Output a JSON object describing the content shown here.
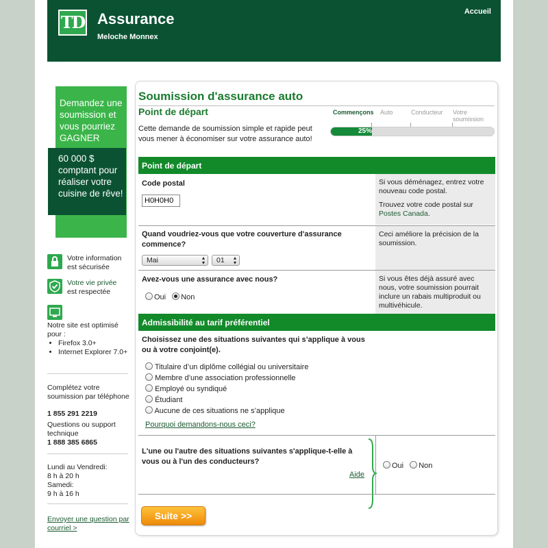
{
  "header": {
    "logo_text": "TD",
    "brand_title": "Assurance",
    "brand_sub": "Meloche Monnex",
    "home_link": "Accueil",
    "bg_color": "#0b5233"
  },
  "promo": {
    "top_text": "Demandez une soumission et vous pourriez GAGNER",
    "bottom_text": "60 000 $ comptant pour réaliser votre cuisine de rêve!"
  },
  "sidebar": {
    "secure": {
      "line1": "Votre information",
      "line2": "est sécurisée",
      "icon": "lock-icon"
    },
    "privacy": {
      "link": "Votre vie privée",
      "line2": "est respectée",
      "icon": "shield-check-icon"
    },
    "browser": {
      "intro": "Notre site est optimisé pour :",
      "items": [
        "Firefox 3.0+",
        "Internet Explorer 7.0+"
      ],
      "icon": "monitor-icon"
    },
    "phone_intro": "Complétez votre soumission par téléphone",
    "phone_number": "1 855 291 2219",
    "support_intro": "Questions ou support technique",
    "support_number": "1 888 385 6865",
    "hours_line1": "Lundi au Vendredi:",
    "hours_line2": "8 h à 20 h",
    "hours_line3": "Samedi:",
    "hours_line4": "9 h à 16 h",
    "email_link": "Envoyer une question par courriel >"
  },
  "form": {
    "title": "Soumission d'assurance auto",
    "subtitle": "Point de départ",
    "intro": "Cette demande de soumission simple et rapide peut vous mener à économiser sur votre assurance auto!",
    "steps": [
      "Commençons",
      "Auto",
      "Conducteur",
      "Votre soumission"
    ],
    "progress_label": "25%",
    "progress_value": 0.25,
    "section1_title": "Point de départ",
    "postal_label": "Code postal",
    "postal_value": "H0H0H0",
    "postal_help1": "Si vous déménagez, entrez votre nouveau code postal.",
    "postal_help2": "Trouvez votre code postal sur",
    "postal_help_link": "Postes Canada",
    "postal_help_end": ".",
    "start_label": "Quand voudriez-vous que votre couverture d'assurance commence?",
    "start_month": "Mai",
    "start_day": "01",
    "start_help": "Ceci améliore la précision de la soumission.",
    "insured_label": "Avez-vous une assurance avec nous?",
    "yes": "Oui",
    "no": "Non",
    "insured_help": "Si vous êtes déjà assuré avec nous, votre soumission pourrait inclure un rabais multiproduit ou multivéhicule.",
    "section2_title": "Admissibilité au tarif préférentiel",
    "situation_label": "Choisissez une des situations suivantes qui s’applique à vous ou à votre conjoint(e).",
    "situations": [
      "Titulaire d’un diplôme collégial ou universitaire",
      "Membre d’une association professionnelle",
      "Employé ou syndiqué",
      "Étudiant",
      "Aucune de ces situations ne s’applique"
    ],
    "why_link": "Pourquoi demandons-nous ceci?",
    "drivers_label": "L'une ou l'autre des situations suivantes s'applique-t-elle à vous ou à l'un des conducteurs?",
    "aide_link": "Aide",
    "submit": "Suite >>",
    "accent_color": "#128a2a",
    "submit_color": "#f5a623"
  }
}
